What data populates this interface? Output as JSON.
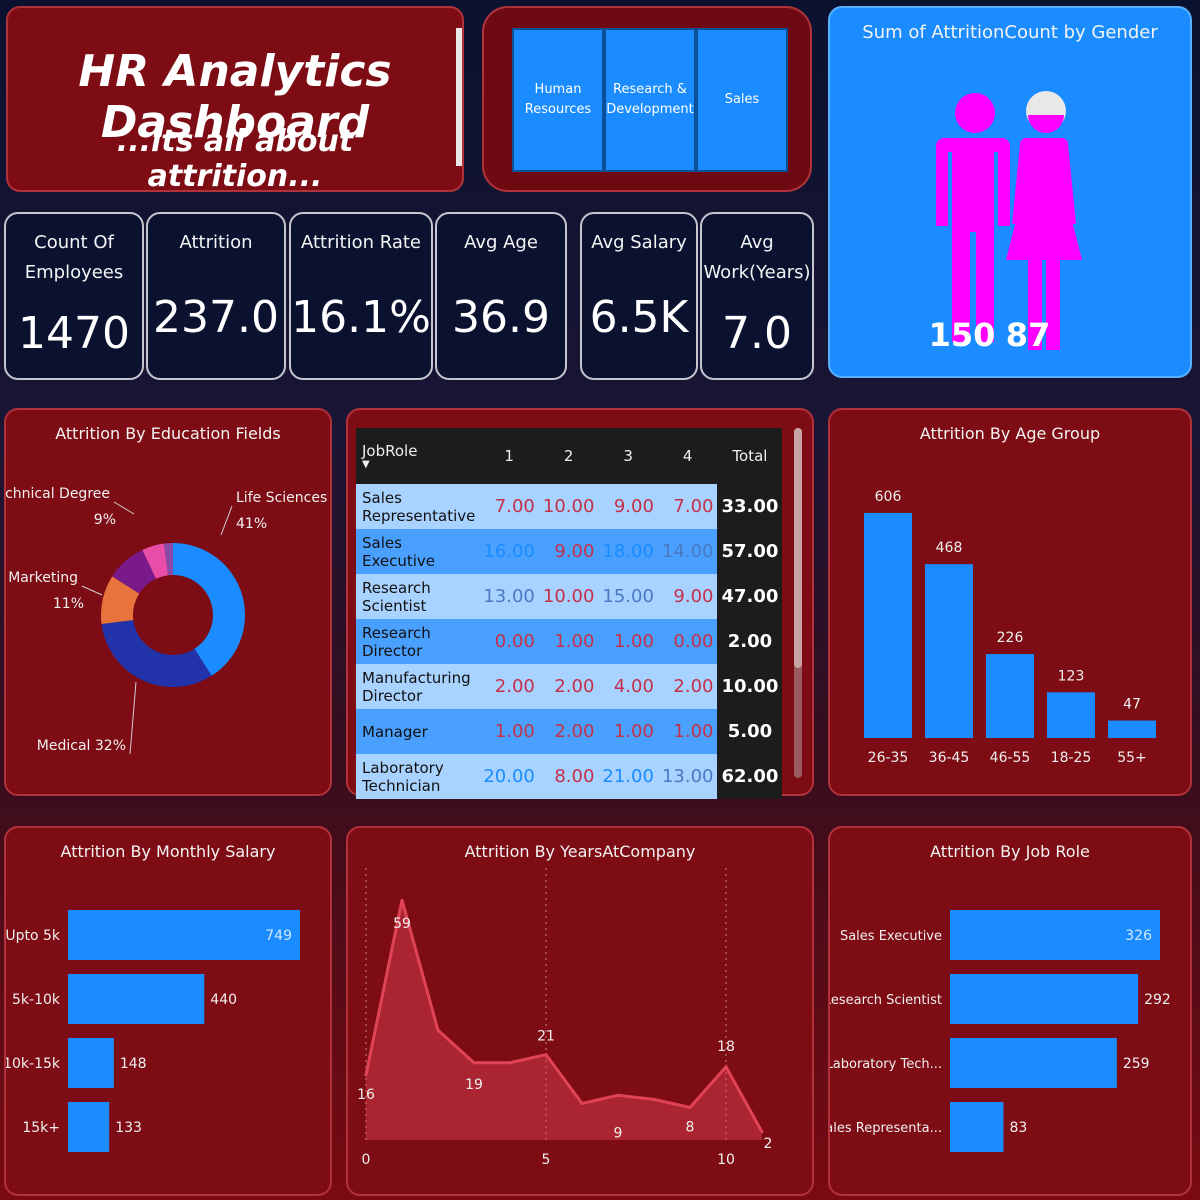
{
  "header": {
    "title": "HR Analytics Dashboard",
    "subtitle": "...its all about attrition..."
  },
  "departments": [
    "Human\nResources",
    "Research &\nDevelopment",
    "Sales"
  ],
  "kpis": [
    {
      "label": "Count Of\nEmployees",
      "value": "1470"
    },
    {
      "label": "Attrition",
      "value": "237.0"
    },
    {
      "label": "Attrition Rate",
      "value": "16.1%"
    },
    {
      "label": "Avg Age",
      "value": "36.9"
    },
    {
      "label": "Avg Salary",
      "value": "6.5K"
    },
    {
      "label": "Avg\nWork(Years)",
      "value": "7.0"
    }
  ],
  "gender": {
    "title": "Sum of AttritionCount by Gender",
    "male": "150",
    "female": "87",
    "figure_color": "#ff00ff",
    "background_color": "#1a8cff"
  },
  "education": {
    "title": "Attrition By Education Fields",
    "chart_data": {
      "type": "pie",
      "donut": true,
      "slices": [
        {
          "label": "Life Sciences",
          "percent": "41%",
          "value": 41,
          "color": "#1a8cff"
        },
        {
          "label": "Medical",
          "percent": "32%",
          "value": 32,
          "color": "#2233aa"
        },
        {
          "label": "Marketing",
          "percent": "11%",
          "value": 11,
          "color": "#e8733c"
        },
        {
          "label": "Technical Degree",
          "percent": "9%",
          "value": 9,
          "color": "#7a1a8a"
        },
        {
          "label": "",
          "percent": "",
          "value": 5,
          "color": "#e84ea8"
        },
        {
          "label": "",
          "percent": "",
          "value": 2,
          "color": "#8a4aa8"
        }
      ]
    }
  },
  "jobtable": {
    "header": [
      "JobRole",
      "1",
      "2",
      "3",
      "4",
      "Total"
    ],
    "sort_icon": "sort-down-icon",
    "rows": [
      {
        "role": "Sales Representative",
        "v": [
          "7.00",
          "10.00",
          "9.00",
          "7.00"
        ],
        "total": "33.00"
      },
      {
        "role": "Sales Executive",
        "v": [
          "16.00",
          "9.00",
          "18.00",
          "14.00"
        ],
        "total": "57.00"
      },
      {
        "role": "Research Scientist",
        "v": [
          "13.00",
          "10.00",
          "15.00",
          "9.00"
        ],
        "total": "47.00"
      },
      {
        "role": "Research Director",
        "v": [
          "0.00",
          "1.00",
          "1.00",
          "0.00"
        ],
        "total": "2.00"
      },
      {
        "role": "Manufacturing Director",
        "v": [
          "2.00",
          "2.00",
          "4.00",
          "2.00"
        ],
        "total": "10.00"
      },
      {
        "role": "Manager",
        "v": [
          "1.00",
          "2.00",
          "1.00",
          "1.00"
        ],
        "total": "5.00"
      },
      {
        "role": "Laboratory Technician",
        "v": [
          "20.00",
          "8.00",
          "21.00",
          "13.00"
        ],
        "total": "62.00"
      }
    ],
    "colors": {
      "low": "#c4304a",
      "mid": "#4a7ac4",
      "high": "#1a8cff",
      "row_light": "#a8d2ff",
      "row_dark": "#4aa0ff"
    }
  },
  "agegroup": {
    "title": "Attrition By Age Group",
    "chart_data": {
      "type": "bar",
      "categories": [
        "26-35",
        "36-45",
        "46-55",
        "18-25",
        "55+"
      ],
      "values": [
        606,
        468,
        226,
        123,
        47
      ],
      "ylim": [
        0,
        700
      ],
      "color": "#1a8cff",
      "data_labels": true
    }
  },
  "salary": {
    "title": "Attrition By Monthly Salary",
    "chart_data": {
      "type": "bar",
      "orientation": "horizontal",
      "categories": [
        "Upto 5k",
        "5k-10k",
        "10k-15k",
        "15k+"
      ],
      "values": [
        749,
        440,
        148,
        133
      ],
      "xlim": [
        0,
        749
      ],
      "color": "#1a8cff",
      "data_labels": true
    }
  },
  "years": {
    "title": "Attrition By YearsAtCompany",
    "chart_data": {
      "type": "area",
      "x": [
        0,
        1,
        2,
        3,
        4,
        5,
        6,
        7,
        8,
        9,
        10,
        11
      ],
      "values": [
        16,
        59,
        27,
        19,
        19,
        21,
        9,
        11,
        10,
        8,
        18,
        2
      ],
      "labeled_points": [
        {
          "x": 0,
          "label": "16"
        },
        {
          "x": 1,
          "label": "59"
        },
        {
          "x": 4,
          "label": "19"
        },
        {
          "x": 5,
          "label": "21"
        },
        {
          "x": 6,
          "label": "9"
        },
        {
          "x": 9,
          "label": "8"
        },
        {
          "x": 10,
          "label": "18"
        },
        {
          "x": 11,
          "label": "2"
        }
      ],
      "xticks": [
        "0",
        "5",
        "10"
      ],
      "xtick_values": [
        0,
        5,
        10
      ],
      "xlim": [
        0,
        11
      ],
      "ylim": [
        0,
        62
      ],
      "color": "#e04454"
    }
  },
  "jobrole": {
    "title": "Attrition By Job Role",
    "chart_data": {
      "type": "bar",
      "orientation": "horizontal",
      "categories": [
        "Sales Executive",
        "Research Scientist",
        "Laboratory Tech...",
        "Sales Representa..."
      ],
      "values": [
        326,
        292,
        259,
        83
      ],
      "xlim": [
        0,
        326
      ],
      "color": "#1a8cff",
      "data_labels": true
    }
  }
}
